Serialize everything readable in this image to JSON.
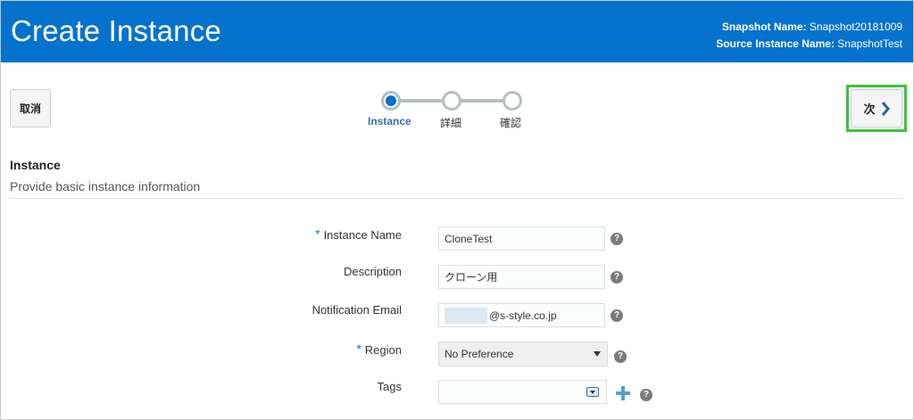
{
  "header": {
    "title": "Create Instance",
    "snapshot_name_label": "Snapshot Name:",
    "snapshot_name_value": "Snapshot20181009",
    "source_instance_label": "Source Instance Name:",
    "source_instance_value": "SnapshotTest"
  },
  "toolbar": {
    "cancel_label": "取消",
    "next_label": "次",
    "next_highlight_color": "#3cc23c"
  },
  "train": {
    "steps": [
      {
        "label": "Instance",
        "state": "active"
      },
      {
        "label": "詳細",
        "state": "pending"
      },
      {
        "label": "確認",
        "state": "pending"
      }
    ]
  },
  "section": {
    "title": "Instance",
    "subtitle": "Provide basic instance information"
  },
  "form": {
    "required_marker": "*",
    "help_glyph": "?",
    "instance_name": {
      "label": "Instance Name",
      "value": "CloneTest",
      "required": true
    },
    "description": {
      "label": "Description",
      "value": "クローン用",
      "required": false
    },
    "notification_email": {
      "label": "Notification Email",
      "value": "@s-style.co.jp",
      "required": false
    },
    "region": {
      "label": "Region",
      "value": "No Preference",
      "required": true
    },
    "tags": {
      "label": "Tags",
      "value": "",
      "required": false
    }
  },
  "colors": {
    "header_bg": "#0572ce",
    "accent": "#0572ce",
    "active_step_text": "#3a6bb1"
  },
  "icons": [
    "chevron-right-icon",
    "help-icon",
    "add-icon",
    "dropdown-icon"
  ]
}
